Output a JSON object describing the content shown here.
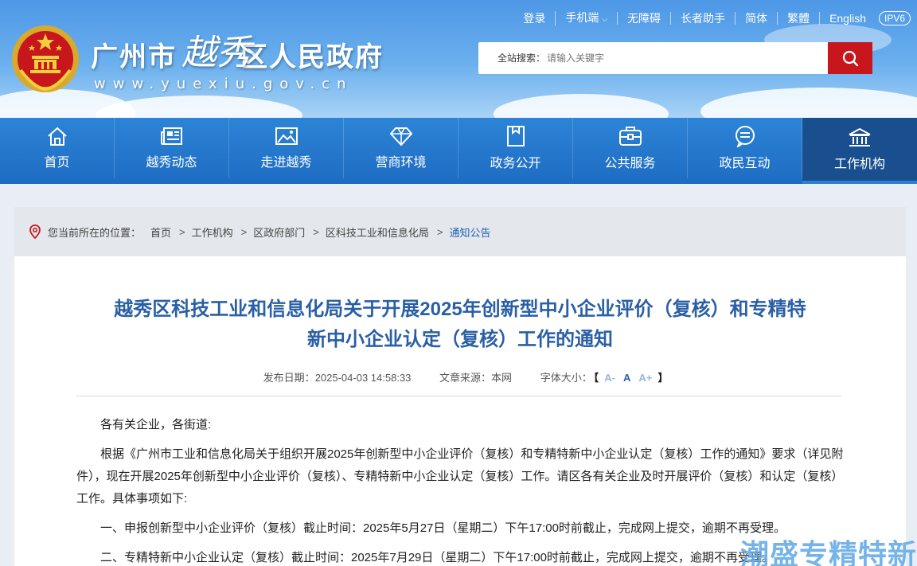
{
  "site": {
    "title_part1": "广州市",
    "title_calli": "越秀",
    "title_part2": "区人民政府",
    "url": "www.yuexiu.gov.cn"
  },
  "toplinks": [
    "登录",
    "手机端",
    "无障碍",
    "长者助手",
    "简体",
    "繁體",
    "English",
    "IPV6"
  ],
  "search": {
    "label": "全站搜索：",
    "placeholder": "请输入关键字"
  },
  "nav": [
    {
      "label": "首页",
      "icon": "home-icon"
    },
    {
      "label": "越秀动态",
      "icon": "news-icon"
    },
    {
      "label": "走进越秀",
      "icon": "picture-icon"
    },
    {
      "label": "营商环境",
      "icon": "diamond-icon"
    },
    {
      "label": "政务公开",
      "icon": "document-icon"
    },
    {
      "label": "公共服务",
      "icon": "briefcase-icon"
    },
    {
      "label": "政民互动",
      "icon": "chat-icon"
    },
    {
      "label": "工作机构",
      "icon": "institution-icon"
    }
  ],
  "breadcrumb": {
    "prefix": "您当前所在的位置：",
    "items": [
      "首页",
      "工作机构",
      "区政府部门",
      "区科技工业和信息化局",
      "通知公告"
    ]
  },
  "article": {
    "title_line1": "越秀区科技工业和信息化局关于开展2025年创新型中小企业评价（复核）和专精特",
    "title_line2": "新中小企业认定（复核）工作的通知",
    "date_label": "发布日期：",
    "date": "2025-04-03 14:58:33",
    "source_label": "文章来源：",
    "source": "本网",
    "font_label": "字体大小：",
    "font_small": "A-",
    "font_mid": "A",
    "font_large": "A+",
    "bracket_open": "【",
    "bracket_close": "】",
    "paragraphs": [
      "各有关企业，各街道:",
      "根据《广州市工业和信息化局关于组织开展2025年创新型中小企业评价（复核）和专精特新中小企业认定（复核）工作的通知》要求（详见附件），现在开展2025年创新型中小企业评价（复核）、专精特新中小企业认定（复核）工作。请区各有关企业及时开展评价（复核）和认定（复核）工作。具体事项如下:",
      "一、申报创新型中小企业评价（复核）截止时间：2025年5月27日（星期二）下午17:00时前截止，完成网上提交，逾期不再受理。",
      "二、专精特新中小企业认定（复核）截止时间：2025年7月29日（星期二）下午17:00时前截止，完成网上提交，逾期不再受理。"
    ]
  },
  "watermark": "潮盛专精特新"
}
